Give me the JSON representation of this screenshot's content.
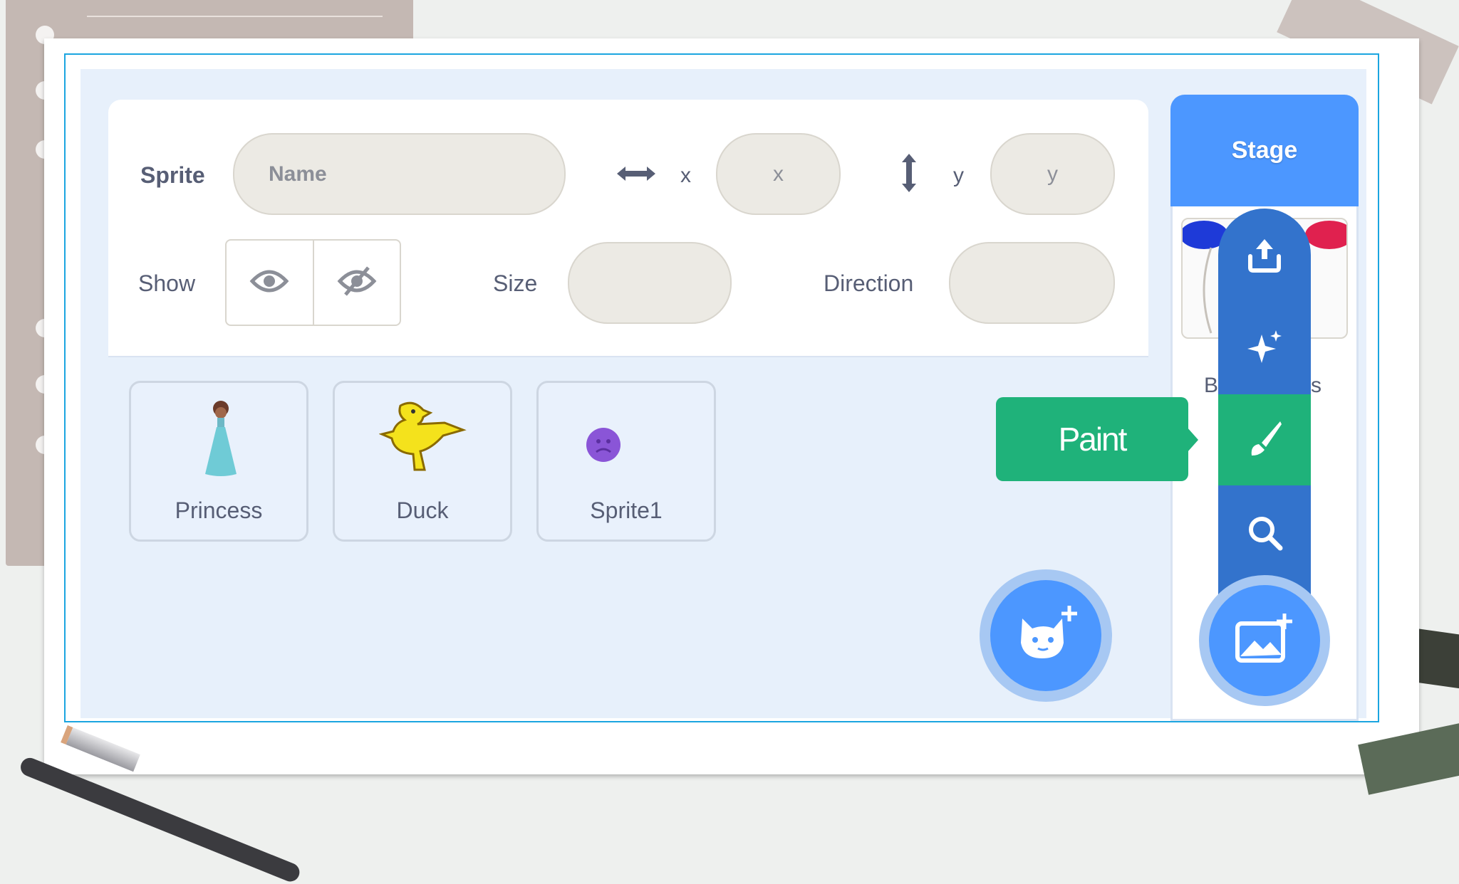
{
  "sprite_info": {
    "sprite_label": "Sprite",
    "name_placeholder": "Name",
    "x_label": "x",
    "x_placeholder": "x",
    "y_label": "y",
    "y_placeholder": "y",
    "show_label": "Show",
    "size_label": "Size",
    "size_value": "",
    "direction_label": "Direction",
    "direction_value": ""
  },
  "sprites": [
    {
      "name": "Princess",
      "icon": "princess-icon"
    },
    {
      "name": "Duck",
      "icon": "duck-icon"
    },
    {
      "name": "Sprite1",
      "icon": "sprite1-icon"
    }
  ],
  "stage": {
    "header": "Stage",
    "backdrops_caption_start": "B",
    "backdrops_caption_end": "s"
  },
  "backdrop_menu": {
    "items": [
      "upload-icon",
      "surprise-icon",
      "paint-icon",
      "search-icon"
    ],
    "tooltip": "Paint"
  },
  "colors": {
    "accent_blue": "#4c97ff",
    "menu_blue": "#3373cc",
    "paint_green": "#1fb27a",
    "frame_cyan": "#1ba5e0"
  }
}
